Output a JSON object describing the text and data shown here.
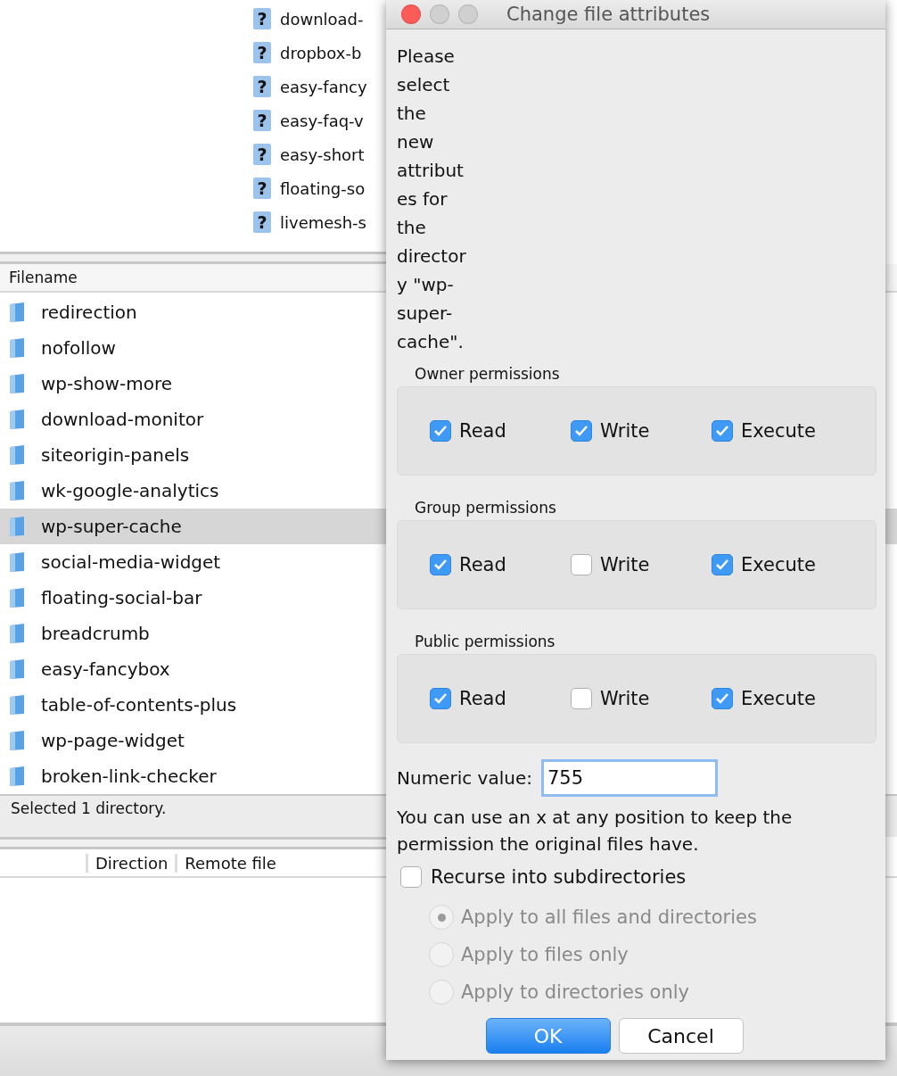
{
  "remote_tree": {
    "items": [
      {
        "icon": "?",
        "name": "download-"
      },
      {
        "icon": "?",
        "name": "dropbox-b"
      },
      {
        "icon": "?",
        "name": "easy-fancy"
      },
      {
        "icon": "?",
        "name": "easy-faq-v"
      },
      {
        "icon": "?",
        "name": "easy-short"
      },
      {
        "icon": "?",
        "name": "floating-so"
      },
      {
        "icon": "?",
        "name": "livemesh-s"
      }
    ]
  },
  "file_list": {
    "columns": [
      "Filename"
    ],
    "rows": [
      {
        "name": "redirection",
        "selected": false
      },
      {
        "name": "nofollow",
        "selected": false
      },
      {
        "name": "wp-show-more",
        "selected": false
      },
      {
        "name": "download-monitor",
        "selected": false
      },
      {
        "name": "siteorigin-panels",
        "selected": false
      },
      {
        "name": "wk-google-analytics",
        "selected": false
      },
      {
        "name": "wp-super-cache",
        "selected": true
      },
      {
        "name": "social-media-widget",
        "selected": false
      },
      {
        "name": "floating-social-bar",
        "selected": false
      },
      {
        "name": "breadcrumb",
        "selected": false
      },
      {
        "name": "easy-fancybox",
        "selected": false
      },
      {
        "name": "table-of-contents-plus",
        "selected": false
      },
      {
        "name": "wp-page-widget",
        "selected": false
      },
      {
        "name": "broken-link-checker",
        "selected": false
      }
    ],
    "status": "Selected 1 directory."
  },
  "queue": {
    "columns": [
      "Direction",
      "Remote file"
    ]
  },
  "dialog": {
    "title": "Change file attributes",
    "message": "Please select the new attributes for the directory \"wp-super-cache\".",
    "groups": [
      {
        "label": "Owner permissions",
        "permissions": [
          {
            "label": "Read",
            "checked": true
          },
          {
            "label": "Write",
            "checked": true
          },
          {
            "label": "Execute",
            "checked": true
          }
        ]
      },
      {
        "label": "Group permissions",
        "permissions": [
          {
            "label": "Read",
            "checked": true
          },
          {
            "label": "Write",
            "checked": false
          },
          {
            "label": "Execute",
            "checked": true
          }
        ]
      },
      {
        "label": "Public permissions",
        "permissions": [
          {
            "label": "Read",
            "checked": true
          },
          {
            "label": "Write",
            "checked": false
          },
          {
            "label": "Execute",
            "checked": true
          }
        ]
      }
    ],
    "numeric": {
      "label": "Numeric value:",
      "value": "755"
    },
    "hint": "You can use an x at any position to keep the permission the original files have.",
    "recurse": {
      "label": "Recurse into subdirectories",
      "checked": false
    },
    "apply_disabled": true,
    "apply_options": [
      {
        "label": "Apply to all files and directories",
        "selected": true
      },
      {
        "label": "Apply to files only",
        "selected": false
      },
      {
        "label": "Apply to directories only",
        "selected": false
      }
    ],
    "buttons": [
      {
        "label": "OK",
        "default": true
      },
      {
        "label": "Cancel",
        "default": false
      }
    ]
  }
}
